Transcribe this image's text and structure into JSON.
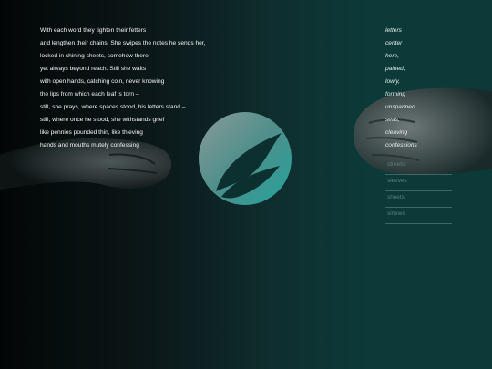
{
  "poem": {
    "lines": [
      "With each word they tighten their fetters",
      "and lengthen their chains. She swipes the notes he sends her,",
      "locked in shining sheets, somehow there",
      "yet always beyond reach. Still she waits",
      "with open hands, catching coin, never knowing",
      "the lips from which each leaf is torn –",
      "still, she prays, where spaces stood, his letters stand –",
      "still, where once he stood, she withstands grief",
      "like pennies pounded thin, like thieving",
      "hands and mouths mutely confessing"
    ]
  },
  "word_list": [
    "letters",
    "center",
    "here,",
    "pained,",
    "lowly,",
    "forming",
    "unspanned",
    "seas,",
    "cleaving",
    "confessions"
  ],
  "options": [
    "streets",
    "sleeves",
    "sheets",
    "sinews"
  ],
  "colors": {
    "logo_fill": "#3c9a96",
    "logo_leaf": "#0c2f30",
    "text": "#f2f4f4",
    "option_text": "#5f7f7e"
  }
}
